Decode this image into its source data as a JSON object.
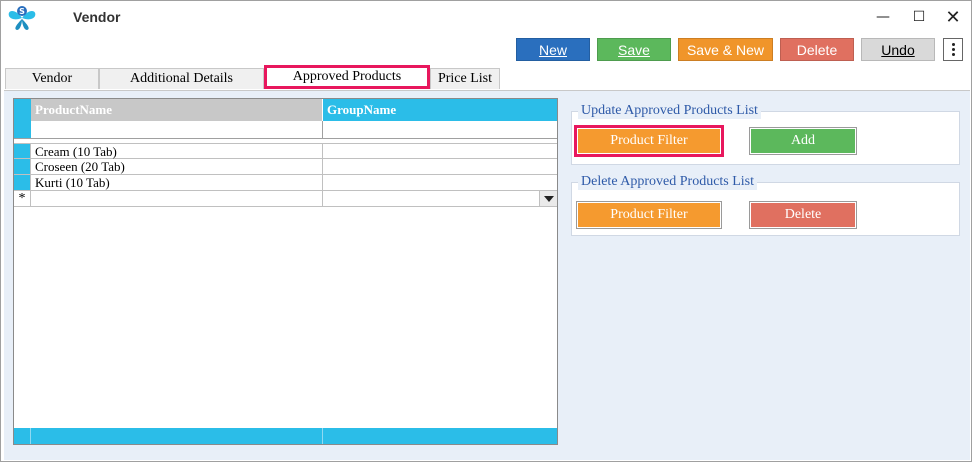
{
  "window": {
    "title": "Vendor",
    "controls": {
      "minimize": "—",
      "maximize": "☐",
      "close": "✕"
    }
  },
  "toolbar": {
    "new_label": "New",
    "save_label": "Save",
    "save_new_label": "Save & New",
    "delete_label": "Delete",
    "undo_label": "Undo"
  },
  "tabs": [
    {
      "label": "Vendor"
    },
    {
      "label": "Additional Details"
    },
    {
      "label": "Approved Products",
      "selected": true,
      "highlighted": true
    },
    {
      "label": "Price List"
    }
  ],
  "grid": {
    "columns": [
      "ProductName",
      "GroupName"
    ],
    "rows": [
      {
        "product": "Cream (10 Tab)",
        "group": ""
      },
      {
        "product": "Croseen (20 Tab)",
        "group": ""
      },
      {
        "product": "Kurti (10 Tab)",
        "group": ""
      }
    ],
    "new_row_marker": "*"
  },
  "update_group": {
    "legend": "Update Approved Products List",
    "filter_label": "Product Filter",
    "add_label": "Add",
    "filter_highlighted": true
  },
  "delete_group": {
    "legend": "Delete Approved Products List",
    "filter_label": "Product Filter",
    "delete_label": "Delete"
  },
  "colors": {
    "new": "#2a6fbe",
    "save": "#5cb85c",
    "save_new": "#f0952a",
    "delete": "#e07060",
    "grid_header": "#2bbde8",
    "highlight": "#e8175d",
    "legend_text": "#2e5aa8"
  },
  "icons": {
    "app_logo": "butterfly-logo-icon",
    "more": "vertical-ellipsis-icon",
    "dropdown": "chevron-down-icon"
  }
}
